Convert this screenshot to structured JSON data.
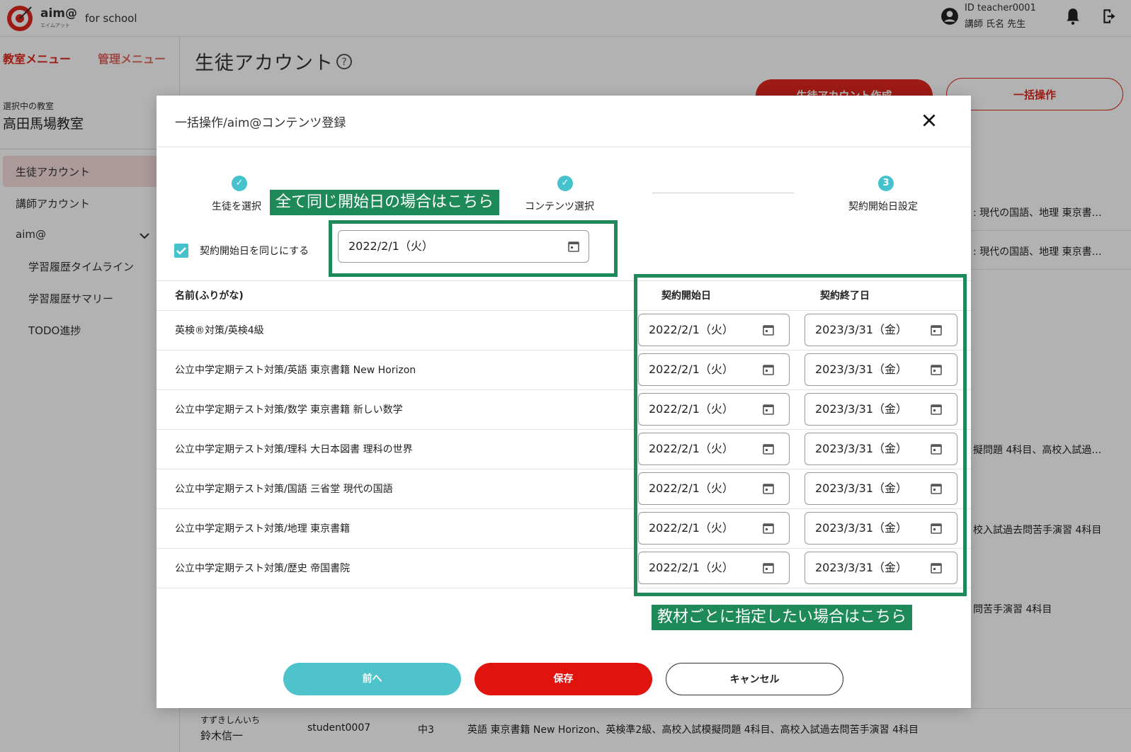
{
  "header": {
    "logo_text": "aim@",
    "logo_sub": "エイムアット",
    "logo_for": "for school",
    "user_id": "ID teacher0001",
    "user_name": "講師 氏名 先生"
  },
  "sidebar": {
    "tabs": [
      "教室メニュー",
      "管理メニュー"
    ],
    "room_caption": "選択中の教室",
    "room_name": "高田馬場教室",
    "items": [
      "生徒アカウント",
      "講師アカウント",
      "aim@",
      "学習履歴タイムライン",
      "学習履歴サマリー",
      "TODO進捗"
    ]
  },
  "main": {
    "title": "生徒アカウント",
    "create_button": "生徒アカウント作成",
    "bulk_button": "一括操作",
    "bg_texts": [
      ": 現代の国語、地理 東京書…",
      ": 現代の国語、地理 東京書…",
      "擬問題 4科目、高校入試過…",
      "校入試過去問苦手演習 4科目",
      "問苦手演習 4科目"
    ],
    "bottom_row": {
      "kana": "すずきしんいち",
      "name": "鈴木信一",
      "id": "student0007",
      "grade": "中3",
      "contents": "英語 東京書籍 New Horizon、英検準2級、高校入試模擬問題 4科目、高校入試過去問苦手演習 4科目"
    }
  },
  "modal": {
    "title": "一括操作/aim@コンテンツ登録",
    "steps": [
      {
        "label": "生徒を選択",
        "state": "done"
      },
      {
        "label": "コンテンツ選択",
        "state": "done"
      },
      {
        "label": "契約開始日設定",
        "state": "current",
        "number": "3"
      }
    ],
    "same_date_label": "契約開始日を同じにする",
    "same_date_value": "2022/2/1（火）",
    "col_name": "名前(ふりがな)",
    "col_start": "契約開始日",
    "col_end": "契約終了日",
    "rows": [
      {
        "name": "英検®対策/英検4級",
        "start": "2022/2/1（火）",
        "end": "2023/3/31（金）"
      },
      {
        "name": "公立中学定期テスト対策/英語 東京書籍 New Horizon",
        "start": "2022/2/1（火）",
        "end": "2023/3/31（金）"
      },
      {
        "name": "公立中学定期テスト対策/数学 東京書籍 新しい数学",
        "start": "2022/2/1（火）",
        "end": "2023/3/31（金）"
      },
      {
        "name": "公立中学定期テスト対策/理科 大日本図書 理科の世界",
        "start": "2022/2/1（火）",
        "end": "2023/3/31（金）"
      },
      {
        "name": "公立中学定期テスト対策/国語 三省堂 現代の国語",
        "start": "2022/2/1（火）",
        "end": "2023/3/31（金）"
      },
      {
        "name": "公立中学定期テスト対策/地理 東京書籍",
        "start": "2022/2/1（火）",
        "end": "2023/3/31（金）"
      },
      {
        "name": "公立中学定期テスト対策/歴史 帝国書院",
        "start": "2022/2/1（火）",
        "end": "2023/3/31（金）"
      }
    ],
    "buttons": {
      "prev": "前へ",
      "save": "保存",
      "cancel": "キャンセル"
    }
  },
  "annotations": {
    "same_date_note": "全て同じ開始日の場合はこちら",
    "per_item_note": "教材ごとに指定したい場合はこちら"
  },
  "colors": {
    "brand_red": "#e0281e",
    "teal": "#45c2cc",
    "annotation_green": "#1e8a5a"
  }
}
